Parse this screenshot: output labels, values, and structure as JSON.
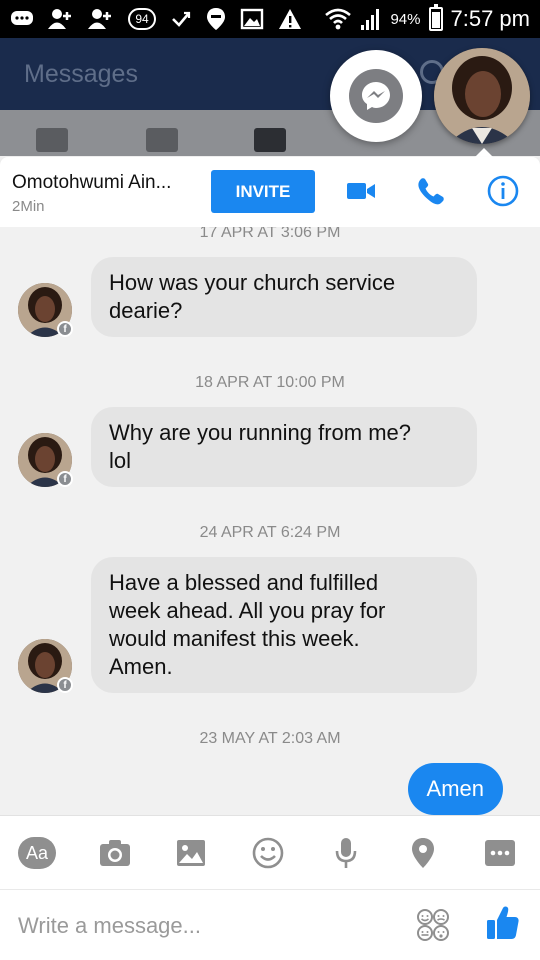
{
  "status_bar": {
    "notification_count": "94",
    "battery_percent": "94%",
    "time": "7:57 pm",
    "icons": [
      "chat-bubble-icon",
      "add-user-icon",
      "add-user-icon",
      "count-badge-icon",
      "check-icon",
      "location-pin-icon",
      "image-icon",
      "warning-icon",
      "wifi-icon",
      "signal-icon",
      "battery-icon"
    ]
  },
  "app": {
    "title": "Messages"
  },
  "chat_header": {
    "contact_name": "Omotohwumi Ain...",
    "status": "2Min",
    "invite_label": "INVITE",
    "accent_color": "#1a87f0"
  },
  "messages": [
    {
      "timestamp": "17 APR AT 3:06 PM",
      "direction": "incoming",
      "text_lines": [
        "How was your church service",
        "dearie?"
      ]
    },
    {
      "timestamp": "18 APR AT 10:00 PM",
      "direction": "incoming",
      "text_lines": [
        "Why are you running from me?",
        "lol"
      ]
    },
    {
      "timestamp": "24 APR AT 6:24 PM",
      "direction": "incoming",
      "text_lines": [
        "Have a blessed and fulfilled",
        "week ahead. All you pray for",
        "would manifest this week.",
        "Amen."
      ]
    },
    {
      "timestamp": "23 MAY AT 2:03 AM",
      "direction": "outgoing",
      "text": "Amen"
    }
  ],
  "toolbar": {
    "text_label": "Aa",
    "icons": [
      "camera-icon",
      "gallery-icon",
      "emoji-icon",
      "microphone-icon",
      "location-icon",
      "more-icon"
    ]
  },
  "composer": {
    "placeholder": "Write a message..."
  }
}
